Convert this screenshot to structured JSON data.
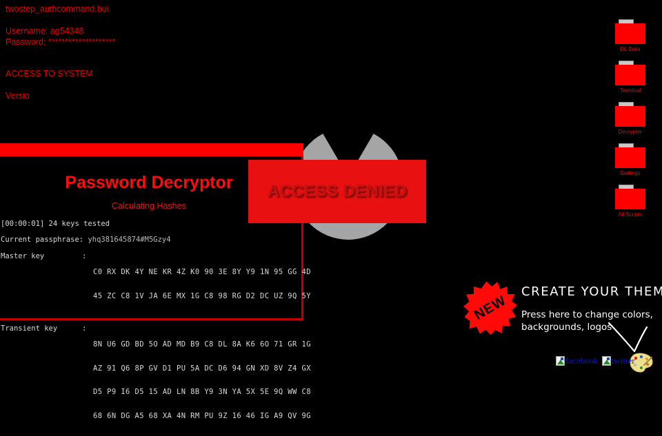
{
  "console": {
    "filename": "twostep_authcommand.bui",
    "username_line": "Username: ag54348",
    "password_line": "Password: ********************",
    "access_line": "ACCESS TO SYSTEM",
    "version_line": "Versio"
  },
  "decryptor": {
    "title": "Password Decryptor",
    "status": "Calculating Hashes",
    "keys_tested": "[00:00:01] 24 keys tested",
    "passphrase_label": "Current passphrase: ",
    "passphrase_value": "yhq381645874#M5Gzy4",
    "master_key_label": "Master key",
    "colon": ":",
    "master_key_rows": [
      "C0 RX DK 4Y NE KR 4Z K0 90 3E 8Y Y9 1N 95 GG 4D",
      "45 ZC C8 1V JA 6E MX 1G C8 98 RG D2 DC UZ 9Q 5Y"
    ],
    "transient_key_label": "Transient key",
    "transient_key_rows": [
      "8N U6 GD BD 5O AD MD B9 C8 DL 8A K6 6O 71 GR 1G",
      "AZ 91 Q6 8P GV D1 PU 5A DC D6 94 GN XD 8V Z4 GX",
      "D5 P9 I6 D5 15 AD LN 8B Y9 3N YA 5X 5E 9Q WW C8",
      "68 6N DG A5 68 XA 4N RM PU 9Z 16 46 IG A9 QV 9G"
    ]
  },
  "access_denied": {
    "label": "ACCESS DENIED"
  },
  "folder_rail": {
    "items": [
      {
        "label": "DL Data",
        "icon": "folder-icon"
      },
      {
        "label": "Terminal",
        "icon": "folder-icon"
      },
      {
        "label": "Decrypter",
        "icon": "folder-icon"
      },
      {
        "label": "Settings",
        "icon": "folder-icon"
      },
      {
        "label": "All Scripts",
        "icon": "folder-icon"
      }
    ]
  },
  "theme_promo": {
    "badge": "NEW",
    "heading": "CREATE YOUR THEME!",
    "subtext": "Press here to change colors, backgrounds, logos",
    "social": [
      {
        "alt": "facebook"
      },
      {
        "alt": "twitter"
      }
    ],
    "palette_icon": "palette-icon",
    "arrow_icon": "curved-arrow-icon"
  },
  "colors": {
    "background": "#000000",
    "accent_red": "#ff0000",
    "text_red": "#e00000",
    "banner_red": "#e81010",
    "logo_grey": "#a5a5a5",
    "mono_text": "#d8d8d8",
    "link_blue": "#0f12c8",
    "palette_yellow": "#efe08c"
  }
}
